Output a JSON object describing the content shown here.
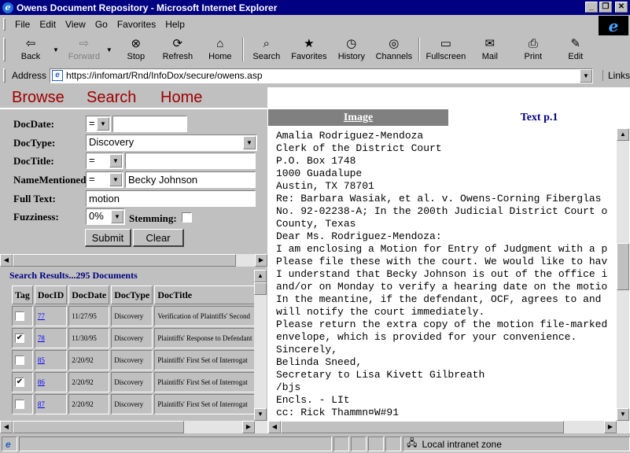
{
  "window": {
    "title": "Owens Document Repository - Microsoft Internet Explorer"
  },
  "menu": [
    "File",
    "Edit",
    "View",
    "Go",
    "Favorites",
    "Help"
  ],
  "toolbar": [
    {
      "label": "Back",
      "icon": "back-arrow-icon",
      "glyph": "⇦",
      "enabled": true,
      "has_dropdown": true
    },
    {
      "label": "Forward",
      "icon": "forward-arrow-icon",
      "glyph": "⇨",
      "enabled": false,
      "has_dropdown": true
    },
    {
      "label": "Stop",
      "icon": "stop-icon",
      "glyph": "⊗",
      "enabled": true
    },
    {
      "label": "Refresh",
      "icon": "refresh-icon",
      "glyph": "⟳",
      "enabled": true
    },
    {
      "label": "Home",
      "icon": "home-icon",
      "glyph": "⌂",
      "enabled": true
    },
    {
      "label": "Search",
      "icon": "search-icon",
      "glyph": "⌕",
      "enabled": true
    },
    {
      "label": "Favorites",
      "icon": "favorites-icon",
      "glyph": "★",
      "enabled": true
    },
    {
      "label": "History",
      "icon": "history-icon",
      "glyph": "◷",
      "enabled": true
    },
    {
      "label": "Channels",
      "icon": "channels-icon",
      "glyph": "◎",
      "enabled": true
    },
    {
      "label": "Fullscreen",
      "icon": "fullscreen-icon",
      "glyph": "▭",
      "enabled": true
    },
    {
      "label": "Mail",
      "icon": "mail-icon",
      "glyph": "✉",
      "enabled": true
    },
    {
      "label": "Print",
      "icon": "print-icon",
      "glyph": "⎙",
      "enabled": true
    },
    {
      "label": "Edit",
      "icon": "edit-icon",
      "glyph": "✎",
      "enabled": true
    }
  ],
  "address": {
    "label": "Address",
    "url": "https://infomart/Rnd/InfoDox/secure/owens.asp",
    "links_label": "Links"
  },
  "nav": {
    "browse": "Browse",
    "search": "Search",
    "home": "Home"
  },
  "form": {
    "docdate": {
      "label": "DocDate:",
      "operator": "=",
      "value": ""
    },
    "doctype": {
      "label": "DocType:",
      "value": "Discovery"
    },
    "doctitle": {
      "label": "DocTitle:",
      "operator": "=",
      "value": ""
    },
    "namementioned": {
      "label": "NameMentioned:",
      "operator": "=",
      "value": "Becky Johnson"
    },
    "fulltext": {
      "label": "Full Text:",
      "value": "motion"
    },
    "fuzziness": {
      "label": "Fuzziness:",
      "value": "0%"
    },
    "stemming": {
      "label": "Stemming:",
      "checked": false
    },
    "submit_label": "Submit",
    "clear_label": "Clear"
  },
  "results": {
    "title": "Search Results...295 Documents",
    "columns": [
      "Tag",
      "DocID",
      "DocDate",
      "DocType",
      "DocTitle"
    ],
    "rows": [
      {
        "tag": false,
        "docid": "77",
        "date": "11/27/95",
        "type": "Discovery",
        "title": "Verification of Plaintiffs' Second"
      },
      {
        "tag": true,
        "docid": "78",
        "date": "11/30/95",
        "type": "Discovery",
        "title": "Plaintiffs' Response to Defendant"
      },
      {
        "tag": false,
        "docid": "85",
        "date": "2/20/92",
        "type": "Discovery",
        "title": "Plaintiffs' First Set of Interrogat"
      },
      {
        "tag": true,
        "docid": "86",
        "date": "2/20/92",
        "type": "Discovery",
        "title": "Plaintiffs' First Set of Interrogat"
      },
      {
        "tag": false,
        "docid": "87",
        "date": "2/20/92",
        "type": "Discovery",
        "title": "Plaintiffs' First Set of Interrogat"
      }
    ]
  },
  "viewer": {
    "tab_image": "Image",
    "tab_text": "Text p.1",
    "lines": [
      "Amalia Rodriguez-Mendoza",
      "Clerk of the District Court",
      "P.O. Box 1748",
      "1000 Guadalupe",
      "Austin, TX 78701",
      "Re: Barbara Wasiak, et al. v. Owens-Corning Fiberglas",
      "No. 92-02238-A; In the 200th Judicial District Court o",
      "County, Texas",
      "Dear Ms. Rodriguez-Mendoza:",
      "I am enclosing a Motion for Entry of Judgment with a p",
      "Please file these with the court. We would like to hav",
      "I understand that Becky Johnson is out of the office i",
      "and/or on Monday to verify a hearing date on the motio",
      "In the meantine, if the defendant, OCF, agrees to and",
      "will notify the court immediately.",
      "Please return the extra copy of the motion file-marked",
      "envelope, which is provided for your convenience.",
      "Sincerely,",
      "Belinda Sneed,",
      "Secretary to Lisa Kivett Gilbreath",
      "/bjs",
      "Encls. - LIt",
      "cc: Rick Thammn¤W#91"
    ]
  },
  "status": {
    "zone": "Local intranet zone"
  },
  "colors": {
    "titlebar": "#000080",
    "nav_link": "#a00000",
    "results_title": "#000080",
    "tab_text": "#000080",
    "tab_image_bg": "#808080"
  }
}
